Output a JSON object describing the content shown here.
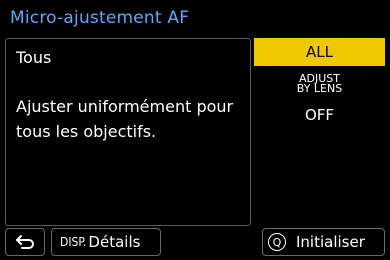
{
  "header": {
    "title": "Micro-ajustement AF"
  },
  "description": {
    "title": "Tous",
    "body": "Ajuster uniformément pour tous les objectifs."
  },
  "options": {
    "all": "ALL",
    "adjust_line1": "ADJUST",
    "adjust_line2": "BY LENS",
    "off": "OFF",
    "selected": "ALL"
  },
  "footer": {
    "back_icon": "return-arrow",
    "disp_key": "DISP.",
    "disp_label": "Détails",
    "q_key": "Q",
    "init_label": "Initialiser"
  },
  "colors": {
    "title": "#5aa9ff",
    "selected_bg": "#f0c800"
  }
}
